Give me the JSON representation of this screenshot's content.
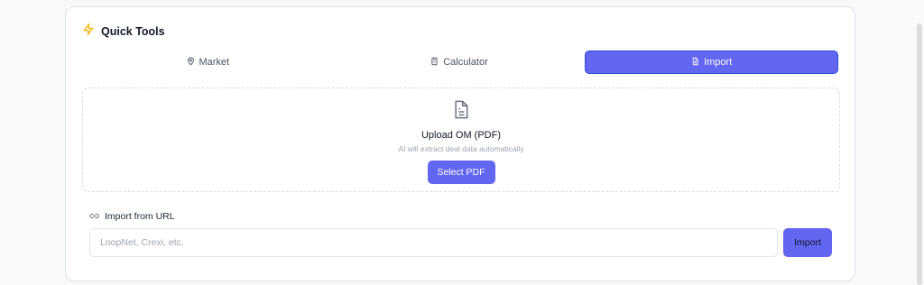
{
  "card": {
    "title": "Quick Tools",
    "title_icon": "lightning-bolt-icon"
  },
  "tabs": [
    {
      "label": "Market",
      "icon": "map-pin-icon",
      "active": false
    },
    {
      "label": "Calculator",
      "icon": "calculator-icon",
      "active": false
    },
    {
      "label": "Import",
      "icon": "file-icon",
      "active": true
    }
  ],
  "upload": {
    "icon": "document-icon",
    "title": "Upload OM (PDF)",
    "subtitle": "AI will extract deal data automatically",
    "button_label": "Select PDF"
  },
  "url_import": {
    "label": "Import from URL",
    "icon": "link-icon",
    "placeholder": "LoopNet, Crexi, etc.",
    "value": "",
    "button_label": "Import"
  },
  "colors": {
    "accent": "#6366f1",
    "accent_border": "#2f4bd6",
    "bolt": "#f5b301",
    "card_border": "#dde1ea"
  }
}
